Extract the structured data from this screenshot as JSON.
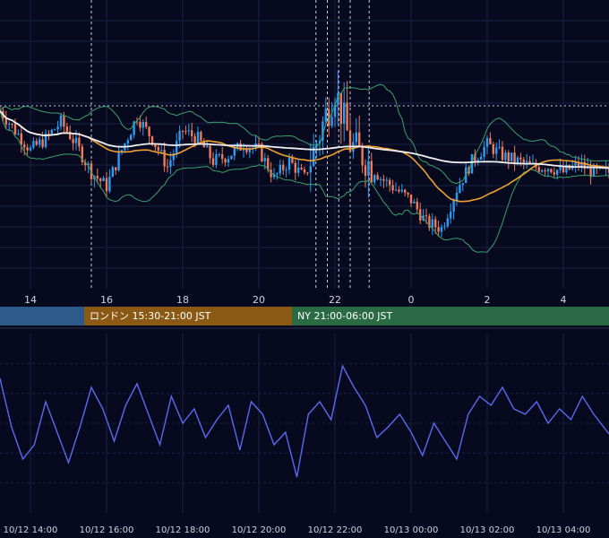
{
  "colors": {
    "background": "#070a1f",
    "grid": "#1a2040",
    "candle_up": "#2a9df4",
    "candle_down": "#f07a5a",
    "ma_long": "#f0f0f0",
    "ma_mid": "#f0a030",
    "bollinger": "#3aa06a",
    "oscillator": "#5a6af0",
    "axis_text": "#d0d4e0",
    "session_tokyo": "#2d5a8a",
    "session_london": "#8a5a14",
    "session_ny": "#2a6a44"
  },
  "sessions": [
    {
      "id": "tokyo",
      "label": ""
    },
    {
      "id": "london",
      "label": "ロンドン 15:30-21:00 JST"
    },
    {
      "id": "ny",
      "label": "NY 21:00-06:00 JST"
    }
  ],
  "chart_data": [
    {
      "type": "candlestick",
      "x_ticks": [
        "14",
        "16",
        "18",
        "20",
        "22",
        "0",
        "2",
        "4"
      ],
      "x_tick_hours": [
        14,
        16,
        18,
        20,
        22,
        24,
        26,
        28
      ],
      "x_range_hours": [
        13.2,
        29.2
      ],
      "y_range": [
        0,
        100
      ],
      "grid": true,
      "vertical_event_lines_hours": [
        15.6,
        21.5,
        21.8,
        22.1,
        22.4,
        22.9
      ],
      "overlays": [
        "moving-average-long",
        "moving-average-mid",
        "bollinger-bands"
      ],
      "series": [
        {
          "hours": [
            13.2,
            13.6,
            14.0,
            14.4,
            14.8,
            15.2,
            15.6,
            16.0,
            16.4,
            16.8,
            17.2,
            17.6,
            18.0,
            18.4,
            18.8,
            19.2,
            19.6,
            20.0,
            20.4,
            20.8,
            21.2,
            21.6,
            22.0,
            22.4,
            22.8,
            23.2,
            23.6,
            24.0,
            24.4,
            24.8,
            25.2,
            25.6,
            26.0,
            26.4,
            26.8,
            27.2,
            27.6,
            28.0,
            28.4,
            28.8,
            29.2
          ],
          "close": [
            62,
            55,
            48,
            52,
            58,
            50,
            40,
            35,
            48,
            60,
            52,
            42,
            55,
            52,
            44,
            46,
            50,
            48,
            38,
            44,
            38,
            54,
            70,
            50,
            45,
            38,
            34,
            30,
            22,
            20,
            34,
            44,
            50,
            46,
            44,
            42,
            42,
            40,
            43,
            40,
            40
          ]
        }
      ]
    },
    {
      "type": "line",
      "x_ticks": [
        "10/12 14:00",
        "10/12 16:00",
        "10/12 18:00",
        "10/12 20:00",
        "10/12 22:00",
        "10/13 00:00",
        "10/13 02:00",
        "10/13 04:00"
      ],
      "x_range_hours": [
        13.2,
        29.2
      ],
      "y_range": [
        0,
        100
      ],
      "grid": true,
      "series": [
        {
          "hours": [
            13.2,
            13.5,
            13.8,
            14.1,
            14.4,
            14.7,
            15.0,
            15.3,
            15.6,
            15.9,
            16.2,
            16.5,
            16.8,
            17.1,
            17.4,
            17.7,
            18.0,
            18.3,
            18.6,
            18.9,
            19.2,
            19.5,
            19.8,
            20.1,
            20.4,
            20.7,
            21.0,
            21.3,
            21.6,
            21.9,
            22.2,
            22.5,
            22.8,
            23.1,
            23.4,
            23.7,
            24.0,
            24.3,
            24.6,
            24.9,
            25.2,
            25.5,
            25.8,
            26.1,
            26.4,
            26.7,
            27.0,
            27.3,
            27.6,
            27.9,
            28.2,
            28.5,
            28.8,
            29.2
          ],
          "values": [
            75,
            48,
            30,
            38,
            62,
            45,
            28,
            48,
            70,
            58,
            40,
            60,
            72,
            55,
            38,
            65,
            50,
            58,
            42,
            52,
            60,
            35,
            62,
            55,
            38,
            45,
            20,
            55,
            62,
            52,
            82,
            70,
            60,
            42,
            48,
            55,
            45,
            32,
            50,
            40,
            30,
            55,
            65,
            60,
            70,
            58,
            55,
            62,
            50,
            58,
            52,
            65,
            55,
            44
          ]
        }
      ]
    }
  ]
}
